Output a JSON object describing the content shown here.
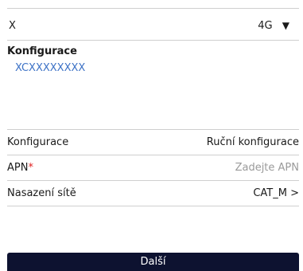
{
  "header": {
    "left": "X",
    "network_value": "4G",
    "dropdown_glyph": "▼"
  },
  "section": {
    "title": "Konfigurace",
    "serial": "XCXXXXXXXX"
  },
  "form": {
    "config_label": "Konfigurace",
    "config_value": "Ruční konfigurace",
    "apn_label": "APN",
    "apn_required": "*",
    "apn_placeholder": "Zadejte APN",
    "deploy_label": "Nasazení sítě",
    "deploy_value": "CAT_M >"
  },
  "footer": {
    "next_label": "Další"
  }
}
